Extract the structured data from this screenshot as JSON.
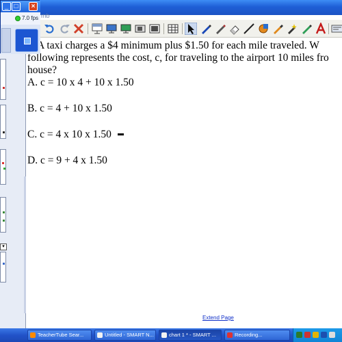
{
  "window": {
    "title_fragment": "mb"
  },
  "recorder": {
    "fps": "7.0 fps",
    "minimize": "_",
    "maximize": "□",
    "close": "×"
  },
  "question": {
    "line1": ") A taxi charges a $4 minimum plus $1.50 for each mile traveled. W",
    "line2": "following represents the cost, c, for traveling to the airport 10 miles fro",
    "line3": "house?"
  },
  "answers": [
    {
      "text": "A.  c = 10 x 4 + 10 x 1.50"
    },
    {
      "text": "B.  c = 4 + 10 x 1.50"
    },
    {
      "text": "C.  c = 4 x 10 x 1.50"
    },
    {
      "text": "D.  c = 9 + 4 x 1.50"
    }
  ],
  "extend_page": "Extend Page",
  "taskbar": {
    "items": [
      {
        "label": "TeacherTube Sear..."
      },
      {
        "label": "Untitled - SMART N..."
      },
      {
        "label": "chart 1 * - SMART ..."
      },
      {
        "label": "Recording..."
      }
    ]
  },
  "icons": {
    "toolbar": [
      "undo-icon",
      "redo-icon",
      "delete-icon",
      "screen-shade-icon",
      "display-icon",
      "projector-icon",
      "capture-icon",
      "table-icon",
      "select-arrow-icon",
      "pen-icon",
      "creative-pen-icon",
      "eraser-icon",
      "line-icon",
      "fill-icon",
      "highlighter-icon",
      "magic-pen-icon",
      "shape-pen-icon",
      "text-icon"
    ]
  },
  "colors": {
    "titlebar": "#1f5fd6",
    "taskbar": "#2253c8",
    "record_dot": "#2fcf31",
    "close_button": "#d8431f",
    "text_tool": "#c41a1a"
  }
}
